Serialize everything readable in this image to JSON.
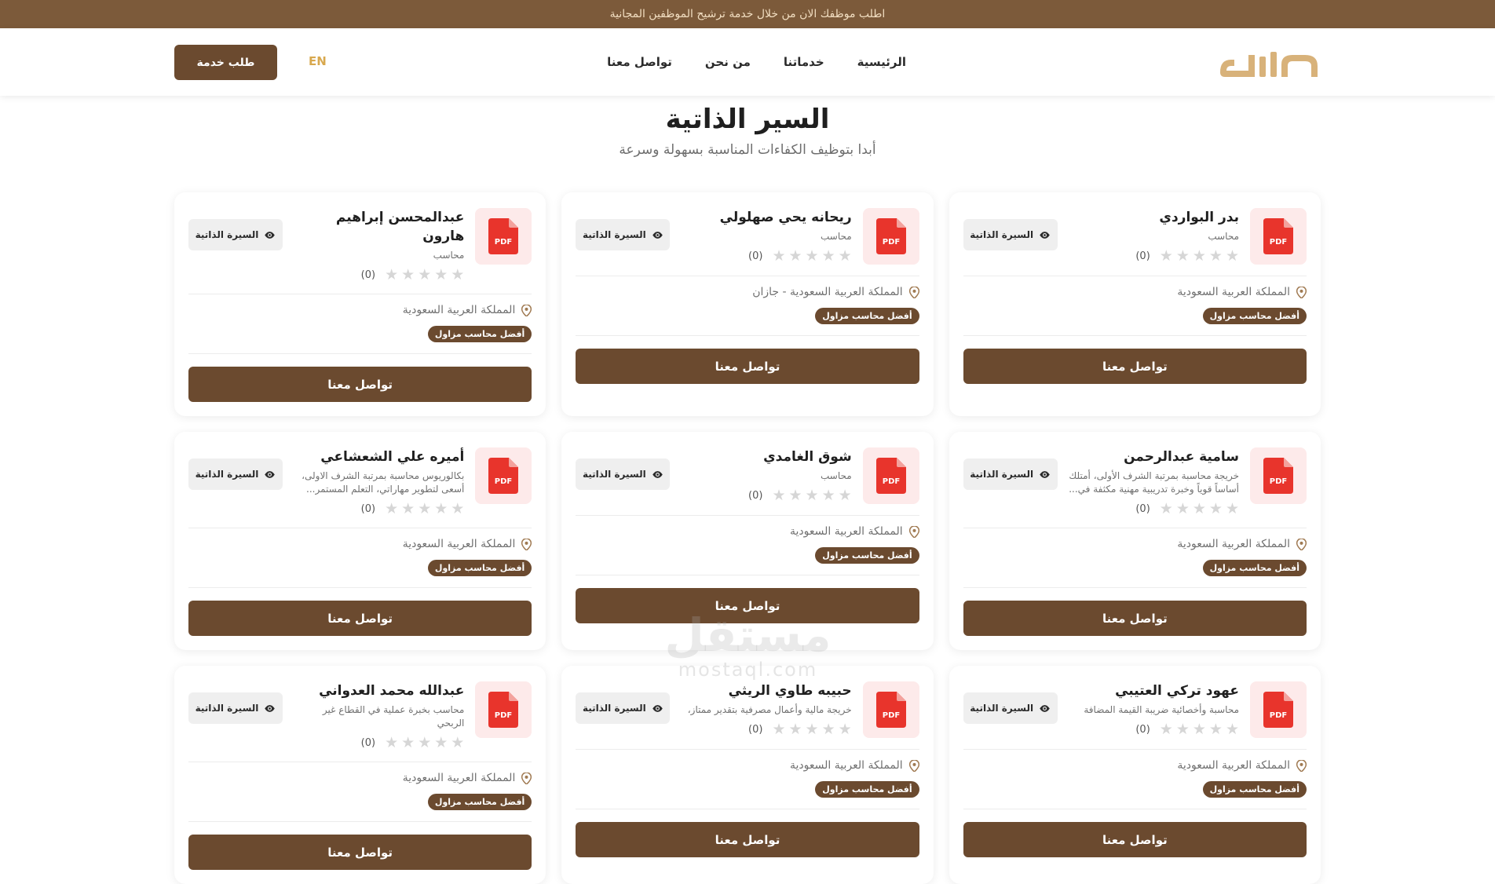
{
  "topbar": {
    "text": "اطلب موظفك الان من خلال خدمة ترشيح الموظفين المجانية"
  },
  "nav": {
    "links": [
      "الرئيسية",
      "خدماتنا",
      "من نحن",
      "تواصل معنا"
    ],
    "lang": "EN",
    "request_label": "طلب خدمة"
  },
  "hero": {
    "title": "السير الذاتية",
    "subtitle": "أبدا بتوظيف الكفاءات المناسبة بسهولة وسرعة"
  },
  "card_labels": {
    "cv_button": "السيرة الذاتية",
    "contact_button": "تواصل معنا",
    "pdf_label": "PDF"
  },
  "cards": [
    {
      "name": "بدر البواردي",
      "role": "محاسب",
      "rating": "(0)",
      "location": "المملكة العربية السعودية",
      "badge": "أفضل محاسب مزاول"
    },
    {
      "name": "ريحانه يحي صهلولي",
      "role": "محاسب",
      "rating": "(0)",
      "location": "المملكة العربية السعودية - جازان",
      "badge": "أفضل محاسب مزاول"
    },
    {
      "name": "عبدالمحسن إبراهيم هارون",
      "role": "محاسب",
      "rating": "(0)",
      "location": "المملكة العربية السعودية",
      "badge": "أفضل محاسب مزاول"
    },
    {
      "name": "سامية عبدالرحمن",
      "role": "خريجة محاسبة بمرتبة الشرف الأولى، أمتلك أساساً قوياً وخبرة تدريبية مهنية مكثفة في...",
      "rating": "(0)",
      "location": "المملكة العربية السعودية",
      "badge": "أفضل محاسب مزاول"
    },
    {
      "name": "شوق الغامدي",
      "role": "محاسب",
      "rating": "(0)",
      "location": "المملكة العربية السعودية",
      "badge": "أفضل محاسب مزاول"
    },
    {
      "name": "أميره علي الشعشاعي",
      "role": "بكالوريوس محاسبة بمرتبة الشرف الاولى، أسعى لتطوير مهاراتي، التعلم المستمر...",
      "rating": "(0)",
      "location": "المملكة العربية السعودية",
      "badge": "أفضل محاسب مزاول"
    },
    {
      "name": "عهود تركي العتيبي",
      "role": "محاسبة وأخصائية ضريبة القيمة المضافة",
      "rating": "(0)",
      "location": "المملكة العربية السعودية",
      "badge": "أفضل محاسب مزاول"
    },
    {
      "name": "حبيبه طاوي الريثي",
      "role": "خريجة مالية وأعمال مصرفية بتقدير ممتاز،",
      "rating": "(0)",
      "location": "المملكة العربية السعودية",
      "badge": "أفضل محاسب مزاول"
    },
    {
      "name": "عبدالله محمد العدواني",
      "role": "محاسب بخبرة عملية في القطاع غير الربحي",
      "rating": "(0)",
      "location": "المملكة العربية السعودية",
      "badge": "أفضل محاسب مزاول"
    }
  ],
  "watermark": {
    "main": "مستقل",
    "sub": "mostaql.com"
  },
  "colors": {
    "topbar": "#7c5a3a",
    "primary": "#6b4a2f",
    "gold": "#d8b27a",
    "pdf_red": "#e8342c"
  },
  "icons": [
    "logo",
    "pdf-file-icon",
    "eye-icon",
    "location-pin-icon",
    "star-icon"
  ]
}
